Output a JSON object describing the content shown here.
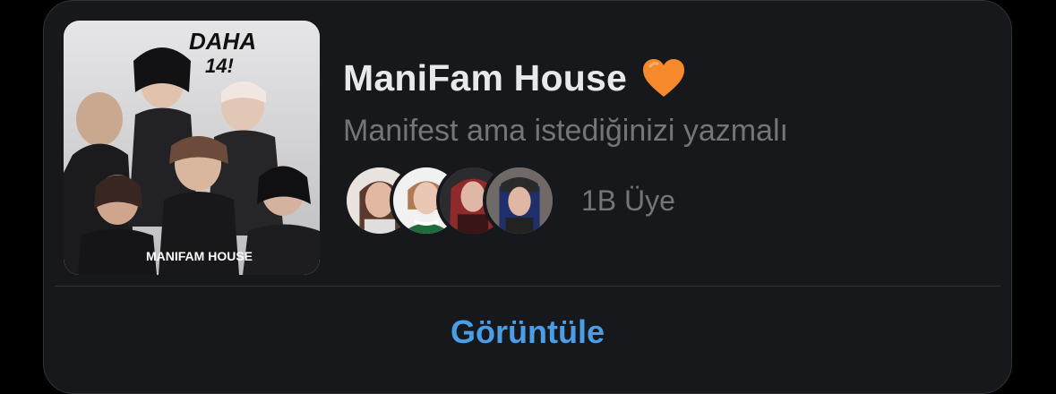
{
  "community": {
    "cover_title_text": "DAHA 14!",
    "cover_brand_text": "MANIFAM HOUSE",
    "title": "ManiFam House",
    "title_emoji_icon": "orange-heart-icon",
    "description": "Manifest ama istediğinizi yazmalı",
    "member_count": "1B Üye",
    "member_avatars": [
      "avatar-1",
      "avatar-2",
      "avatar-3",
      "avatar-4"
    ]
  },
  "actions": {
    "view_label": "Görüntüle"
  },
  "colors": {
    "card_background": "#16181c",
    "title_text": "#e7e9ea",
    "secondary_text": "#71767b",
    "accent_blue": "#4a9ee8",
    "heart_orange": "#f6892c"
  }
}
